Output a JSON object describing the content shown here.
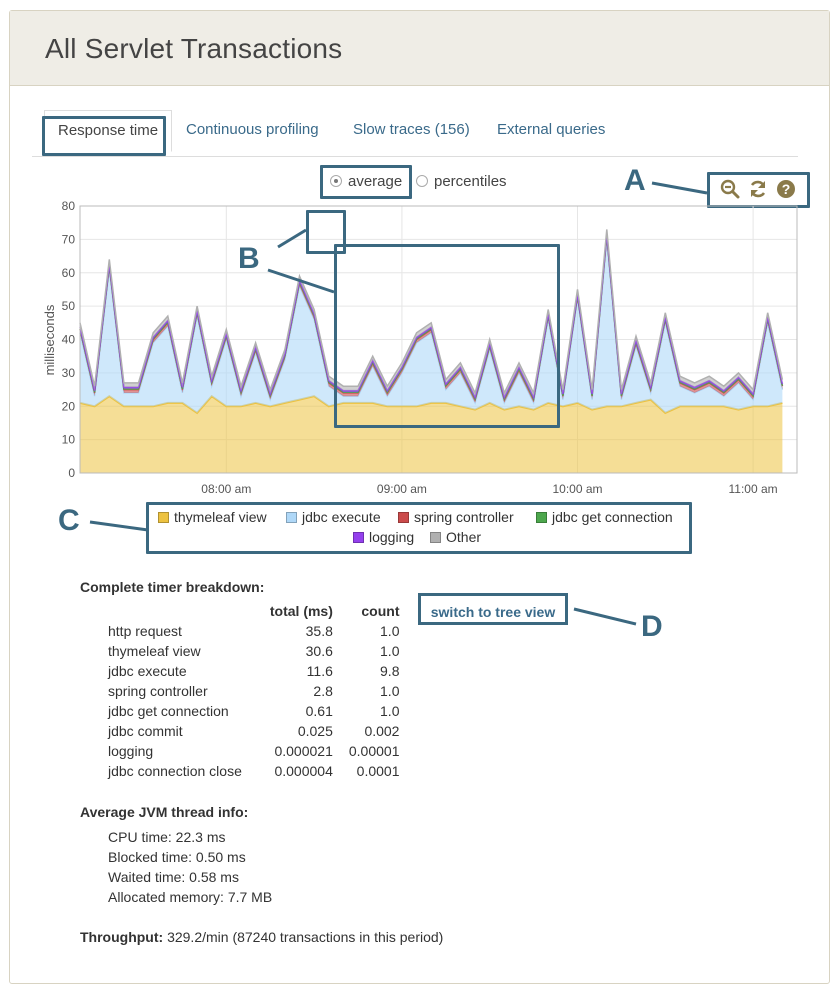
{
  "header": {
    "title": "All Servlet Transactions"
  },
  "tabs": [
    {
      "label": "Response time",
      "active": true
    },
    {
      "label": "Continuous profiling"
    },
    {
      "label": "Slow traces (156)"
    },
    {
      "label": "External queries"
    }
  ],
  "mode": {
    "average_label": "average",
    "percentiles_label": "percentiles",
    "selected": "average"
  },
  "toolbar_icons": [
    "zoom-out-icon",
    "refresh-icon",
    "help-icon"
  ],
  "callouts": {
    "a": "A",
    "b": "B",
    "c": "C",
    "d": "D"
  },
  "colors": {
    "thymeleaf view": "#edc240",
    "jdbc execute": "#afd8f8",
    "spring controller": "#cb4b4b",
    "jdbc get connection": "#4da74d",
    "logging": "#9440ed",
    "Other": "#b0b0b0",
    "accent": "#3b6880"
  },
  "chart_data": {
    "type": "area",
    "stacked": true,
    "ylabel": "milliseconds",
    "ylim": [
      0,
      80
    ],
    "yticks": [
      0,
      10,
      20,
      30,
      40,
      50,
      60,
      70,
      80
    ],
    "xlim": [
      "07:10",
      "11:15"
    ],
    "xticks": [
      "08:00 am",
      "09:00 am",
      "10:00 am",
      "11:00 am"
    ],
    "xtick_times": [
      "08:00",
      "09:00",
      "10:00",
      "11:00"
    ],
    "grid": true,
    "legend_position": "bottom",
    "x": [
      "07:10",
      "07:15",
      "07:20",
      "07:25",
      "07:30",
      "07:35",
      "07:40",
      "07:45",
      "07:50",
      "07:55",
      "08:00",
      "08:05",
      "08:10",
      "08:15",
      "08:20",
      "08:25",
      "08:30",
      "08:35",
      "08:40",
      "08:45",
      "08:50",
      "08:55",
      "09:00",
      "09:05",
      "09:10",
      "09:15",
      "09:20",
      "09:25",
      "09:30",
      "09:35",
      "09:40",
      "09:45",
      "09:50",
      "09:55",
      "10:00",
      "10:05",
      "10:10",
      "10:15",
      "10:20",
      "10:25",
      "10:30",
      "10:35",
      "10:40",
      "10:45",
      "10:50",
      "10:55",
      "11:00",
      "11:05",
      "11:10"
    ],
    "series": [
      {
        "name": "thymeleaf view",
        "values": [
          21,
          20,
          23,
          20,
          20,
          20,
          21,
          21,
          18,
          23,
          20,
          20,
          21,
          20,
          21,
          22,
          23,
          20,
          21,
          21,
          21,
          20,
          20,
          20,
          21,
          21,
          20,
          19,
          21,
          19,
          20,
          19,
          21,
          20,
          21,
          19,
          20,
          20,
          21,
          22,
          18,
          20,
          20,
          20,
          20,
          19,
          20,
          20,
          21,
          20,
          19,
          19,
          18
        ]
      },
      {
        "name": "jdbc execute",
        "values": [
          21,
          3,
          38,
          4,
          4,
          19,
          23,
          3,
          29,
          3,
          20,
          3,
          15,
          2,
          13,
          34,
          23,
          6,
          2,
          2,
          11,
          3,
          10,
          19,
          21,
          4,
          10,
          2,
          16,
          2,
          10,
          2,
          25,
          2,
          31,
          3,
          50,
          2,
          17,
          2,
          27,
          6,
          4,
          6,
          3,
          8,
          2,
          25,
          4,
          12,
          17,
          20,
          12,
          5
        ]
      },
      {
        "name": "spring controller",
        "values": [
          1,
          1,
          1,
          1,
          1,
          1,
          1,
          1,
          1,
          1,
          1,
          1,
          1,
          1,
          1,
          1,
          1,
          1,
          1,
          1,
          1,
          1,
          1,
          1,
          1,
          1,
          1,
          1,
          1,
          1,
          1,
          1,
          1,
          1,
          1,
          1,
          1,
          1,
          1,
          1,
          1,
          1,
          1,
          1,
          1,
          1,
          1,
          1,
          1,
          1,
          1,
          1,
          1,
          1
        ]
      },
      {
        "name": "jdbc get connection",
        "values": [
          0.2,
          0.2,
          0.2,
          0.2,
          0.2,
          0.2,
          0.2,
          0.2,
          0.2,
          0.2,
          0.2,
          0.2,
          0.2,
          0.2,
          0.2,
          0.2,
          0.2,
          0.2,
          0.2,
          0.2,
          0.2,
          0.2,
          0.2,
          0.2,
          0.2,
          0.2,
          0.2,
          0.2,
          0.2,
          0.2,
          0.2,
          0.2,
          0.2,
          0.2,
          0.2,
          0.2,
          0.2,
          0.2,
          0.2,
          0.2,
          0.2,
          0.2,
          0.2,
          0.2,
          0.2,
          0.2,
          0.2,
          0.2,
          0.2,
          0.2,
          0.2,
          0.2,
          0.2,
          0.2
        ]
      },
      {
        "name": "logging",
        "values": [
          0.5,
          0.5,
          0.5,
          0.5,
          0.5,
          0.5,
          0.5,
          0.5,
          0.5,
          0.5,
          0.5,
          0.5,
          0.5,
          0.5,
          0.5,
          0.5,
          0.5,
          0.5,
          0.5,
          0.5,
          0.5,
          0.5,
          0.5,
          0.5,
          0.5,
          0.5,
          0.5,
          0.5,
          0.5,
          0.5,
          0.5,
          0.5,
          0.5,
          0.5,
          0.5,
          0.5,
          0.5,
          0.5,
          0.5,
          0.5,
          0.5,
          0.5,
          0.5,
          0.5,
          0.5,
          0.5,
          0.5,
          0.5,
          0.5,
          0.5,
          0.5,
          0.5,
          0.5,
          0.5
        ]
      },
      {
        "name": "Other",
        "values": [
          1.3,
          1.3,
          1.3,
          1.3,
          1.3,
          1.3,
          1.3,
          1.3,
          1.3,
          1.3,
          1.3,
          1.3,
          1.3,
          1.3,
          1.3,
          1.3,
          1.3,
          1.3,
          1.3,
          1.3,
          1.3,
          1.3,
          1.3,
          1.3,
          1.3,
          1.3,
          1.3,
          1.3,
          1.3,
          1.3,
          1.3,
          1.3,
          1.3,
          1.3,
          1.3,
          1.3,
          1.3,
          1.3,
          1.3,
          1.3,
          1.3,
          1.3,
          1.3,
          1.3,
          1.3,
          1.3,
          1.3,
          1.3,
          1.3,
          1.3,
          1.3,
          1.3,
          1.3,
          1.3
        ]
      }
    ]
  },
  "legend": [
    {
      "name": "thymeleaf view",
      "color": "#edc240"
    },
    {
      "name": "jdbc execute",
      "color": "#afd8f8"
    },
    {
      "name": "spring controller",
      "color": "#cb4b4b"
    },
    {
      "name": "jdbc get connection",
      "color": "#4da74d"
    },
    {
      "name": "logging",
      "color": "#9440ed"
    },
    {
      "name": "Other",
      "color": "#b0b0b0"
    }
  ],
  "breakdown": {
    "title": "Complete timer breakdown:",
    "col_total": "total (ms)",
    "col_count": "count",
    "switch_label": "switch to tree view",
    "rows": [
      {
        "name": "http request",
        "total": "35.8",
        "count": "1.0"
      },
      {
        "name": "thymeleaf view",
        "total": "30.6",
        "count": "1.0"
      },
      {
        "name": "jdbc execute",
        "total": "11.6",
        "count": "9.8"
      },
      {
        "name": "spring controller",
        "total": "2.8",
        "count": "1.0"
      },
      {
        "name": "jdbc get connection",
        "total": "0.61",
        "count": "1.0"
      },
      {
        "name": "jdbc commit",
        "total": "0.025",
        "count": "0.002"
      },
      {
        "name": "logging",
        "total": "0.000021",
        "count": "0.00001"
      },
      {
        "name": "jdbc connection close",
        "total": "0.000004",
        "count": "0.0001"
      }
    ]
  },
  "jvm": {
    "title": "Average JVM thread info:",
    "cpu": "CPU time: 22.3 ms",
    "blocked": "Blocked time: 0.50 ms",
    "waited": "Waited time: 0.58 ms",
    "allocated": "Allocated memory: 7.7 MB"
  },
  "throughput": {
    "label": "Throughput:",
    "value": "329.2/min (87240 transactions in this period)"
  }
}
